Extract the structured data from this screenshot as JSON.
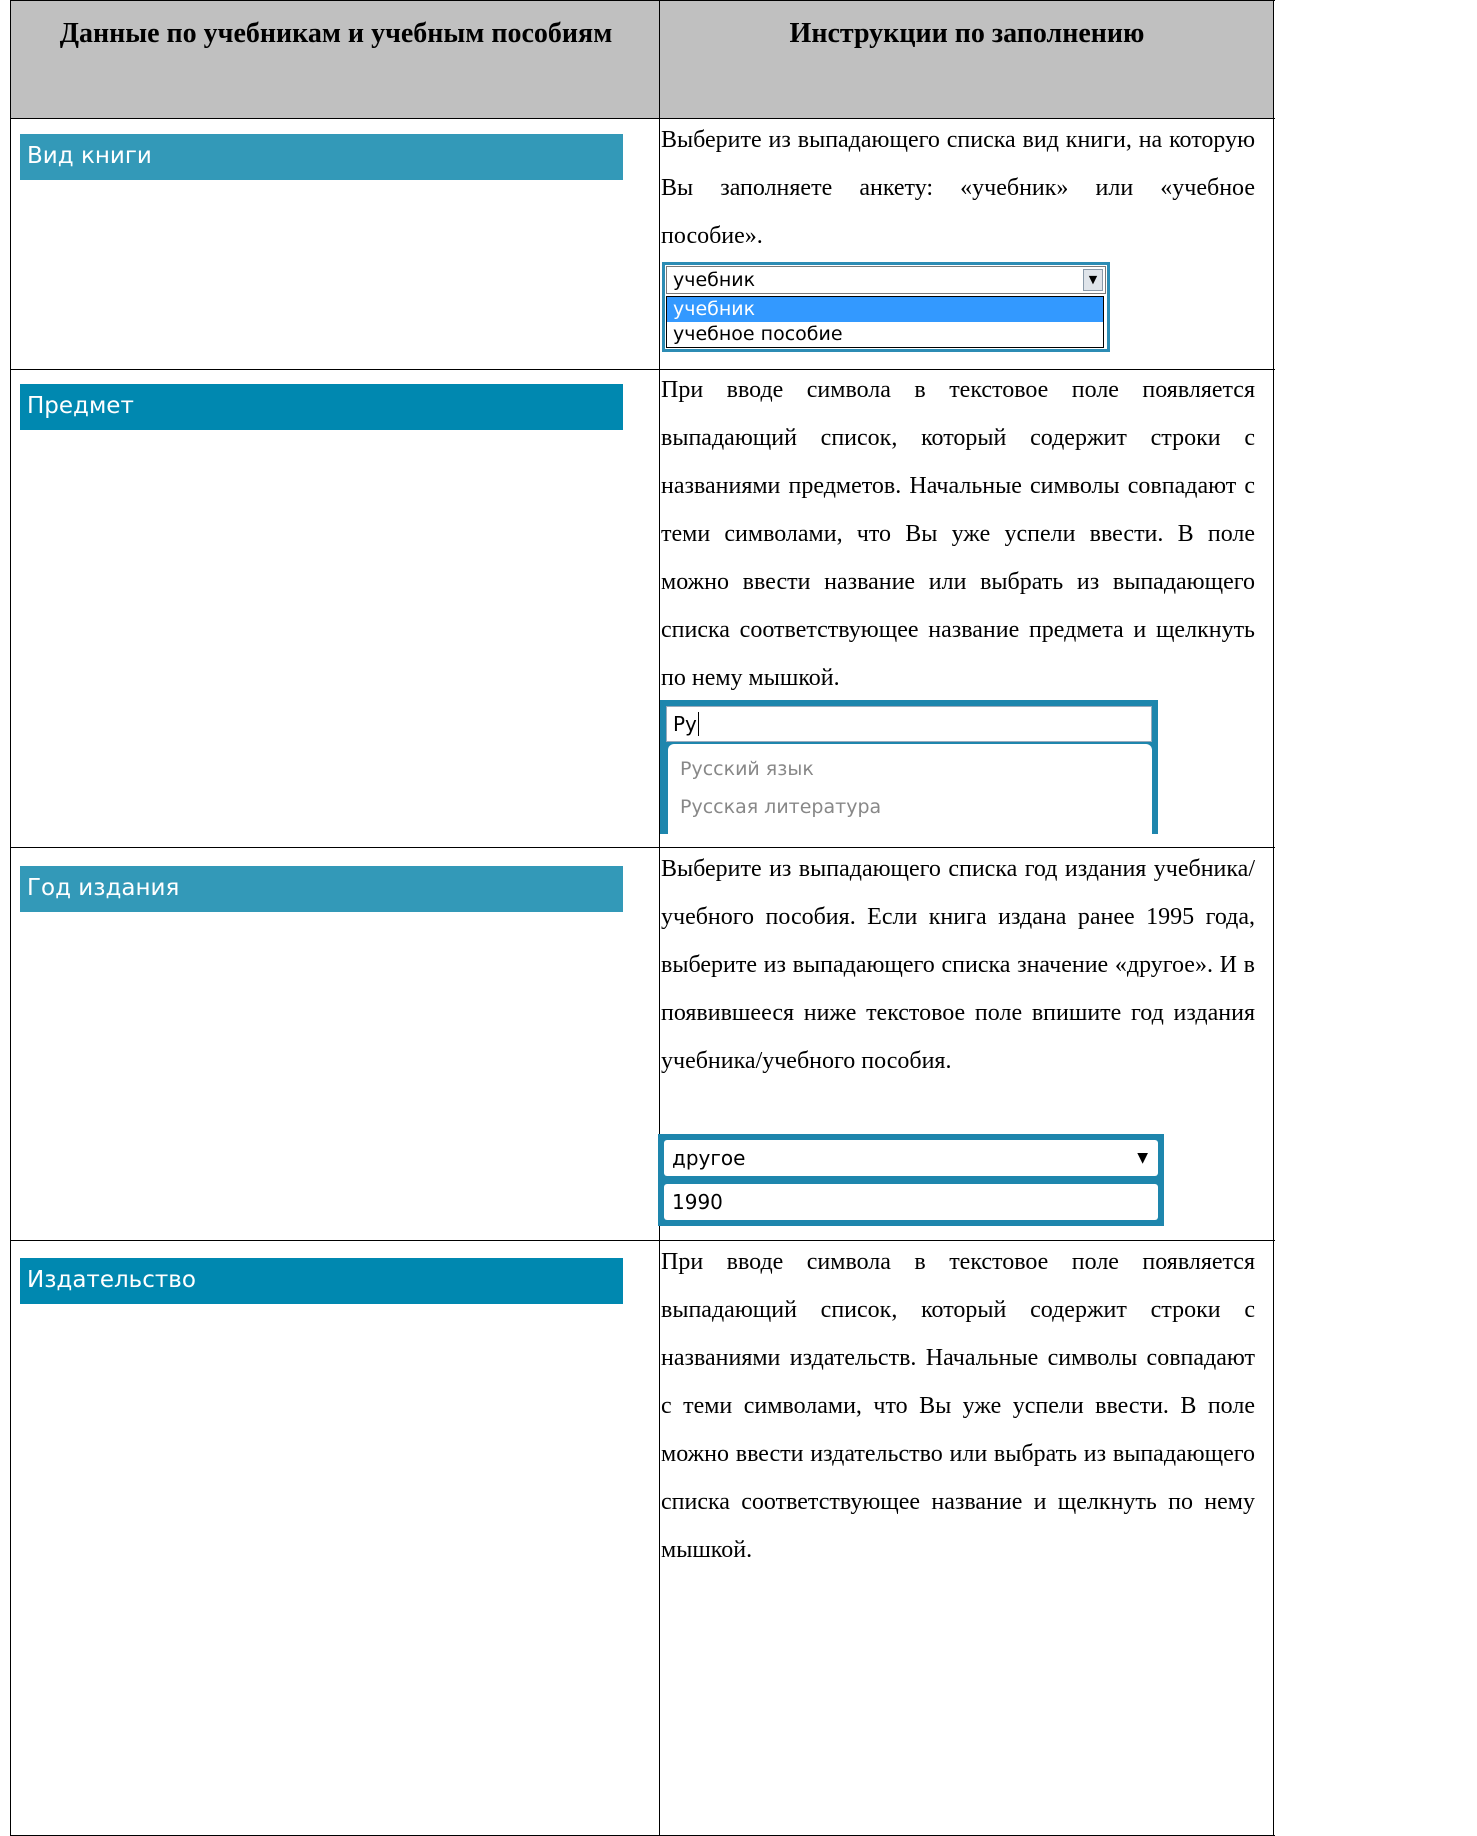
{
  "header": {
    "col1": "Данные по учебникам и учебным пособиям",
    "col2": "Инструкции по заполнению"
  },
  "colors": {
    "header_bg": "#c0c0c0",
    "label_bar_light": "#3399b8",
    "label_bar_dark": "#0088b0",
    "widget_frame": "#1e86ad",
    "selected_option": "#3399ff"
  },
  "rows": [
    {
      "label": "Вид книги",
      "instruction": "Выберите из выпадающего списка вид книги, на которую Вы заполняете анкету: «учебник» или «учебное пособие».",
      "widget": {
        "selected": "учебник",
        "options": [
          "учебник",
          "учебное пособие"
        ]
      }
    },
    {
      "label": "Предмет",
      "instruction": "При вводе символа в текстовое поле появляется выпадающий список, который содержит строки с названиями предметов. Начальные символы совпадают с теми символами, что Вы уже успели ввести. В поле можно ввести название или выбрать из выпадающего списка соответствующее название предмета и щелкнуть по нему мышкой.",
      "widget": {
        "input_value": "Ру",
        "suggestions": [
          "Русский язык",
          "Русская литература"
        ]
      }
    },
    {
      "label": "Год издания",
      "instruction": "Выберите из выпадающего списка год издания учебника/учебного пособия. Если книга издана ранее 1995 года, выберите из выпадающего списка значение «другое». И в появившееся ниже текстовое поле впишите год издания учебника/учебного пособия.",
      "widget": {
        "selected": "другое",
        "input_value": "1990"
      }
    },
    {
      "label": "Издательство",
      "instruction": "При вводе символа в текстовое поле появляется выпадающий список, который содержит строки с названиями издательств. Начальные символы совпадают с теми символами, что Вы уже успели ввести. В поле можно ввести издательство или выбрать из выпадающего списка соответствующее название и щелкнуть по нему мышкой."
    }
  ]
}
